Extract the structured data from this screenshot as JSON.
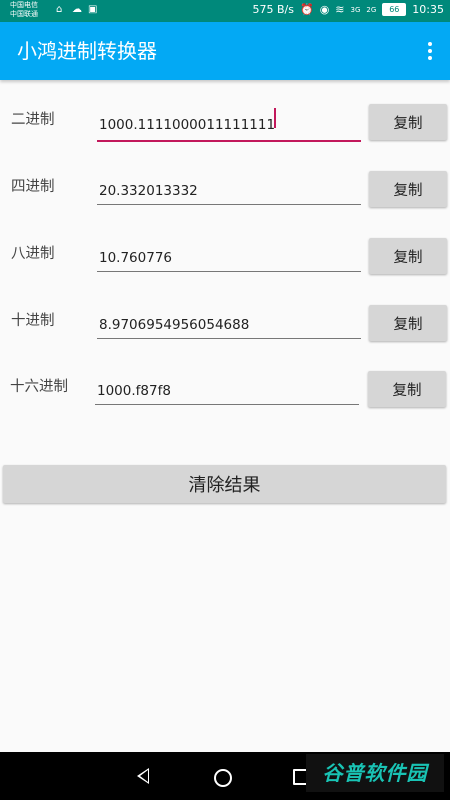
{
  "status_bar": {
    "carrier_1": "中国电信",
    "carrier_2": "中国联通",
    "net_speed": "575 B/s",
    "signal_1": "3G",
    "signal_2": "2G",
    "battery": "66",
    "time": "10:35"
  },
  "app_bar": {
    "title": "小鸿进制转换器"
  },
  "rows": [
    {
      "label": "二进制",
      "value": "1000.1111000011111111",
      "copy_label": "复制"
    },
    {
      "label": "四进制",
      "value": "20.332013332",
      "copy_label": "复制"
    },
    {
      "label": "八进制",
      "value": "10.760776",
      "copy_label": "复制"
    },
    {
      "label": "十进制",
      "value": "8.9706954956054688",
      "copy_label": "复制"
    },
    {
      "label": "十六进制",
      "value": "1000.f87f8",
      "copy_label": "复制"
    }
  ],
  "clear_button": {
    "label": "清除结果"
  },
  "watermark": {
    "text": "谷普软件园"
  },
  "colors": {
    "status_bar": "#00897b",
    "app_bar": "#03a9f4",
    "focus_accent": "#c2185b"
  }
}
